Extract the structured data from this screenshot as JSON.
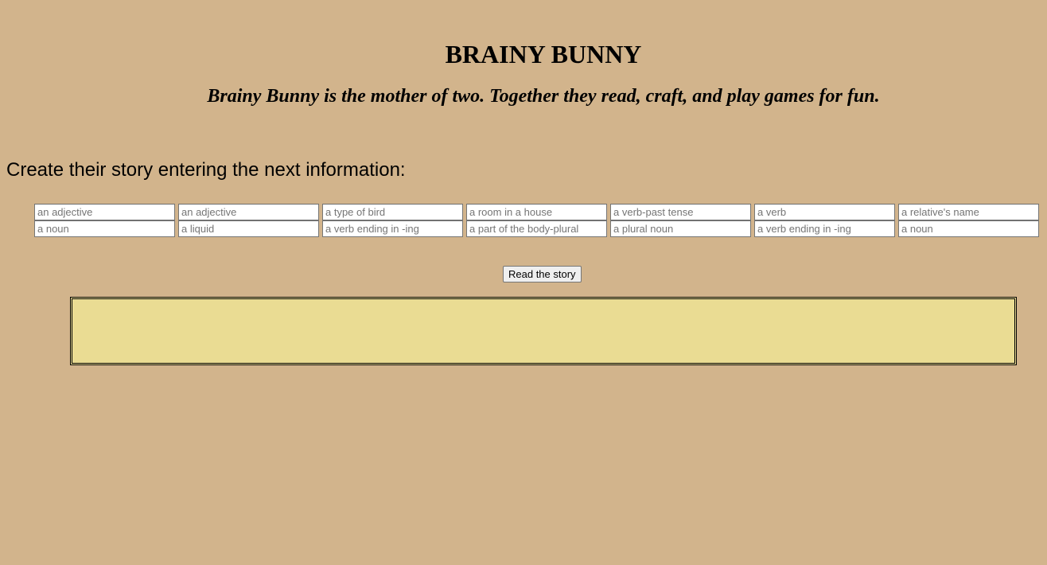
{
  "header": {
    "title": "BRAINY BUNNY",
    "subtitle": "Brainy Bunny is the mother of two. Together they read, craft, and play games for fun."
  },
  "form": {
    "instruction": "Create their story entering the next information:",
    "rows": [
      [
        "an adjective",
        "an adjective",
        "a type of bird",
        "a room in a house",
        "a verb-past tense",
        "a verb",
        "a relative's name"
      ],
      [
        "a noun",
        "a liquid",
        "a verb ending in -ing",
        "a part of the body-plural",
        "a plural noun",
        "a verb ending in -ing",
        "a noun"
      ]
    ],
    "submit_label": "Read the story"
  },
  "story": {
    "text": ""
  },
  "colors": {
    "background": "#d2b48c",
    "story_box": "#eadc93"
  }
}
